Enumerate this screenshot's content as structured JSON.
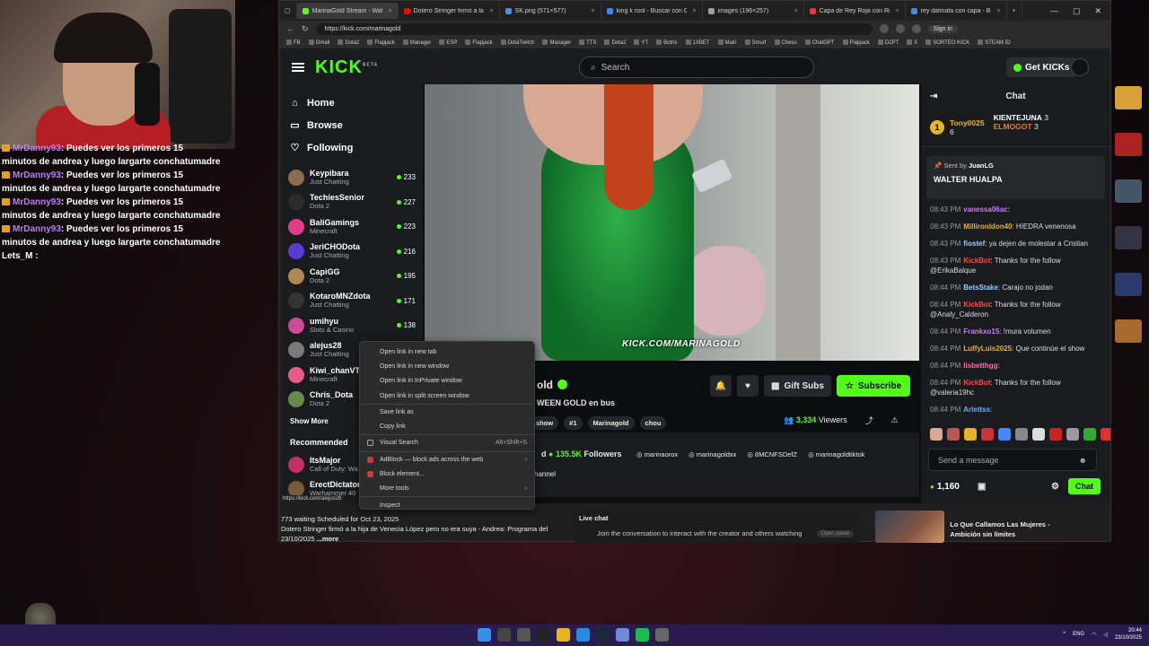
{
  "overlay_chat": [
    {
      "user": "MrDanny93",
      "text": ": Puedes ver los primeros 15",
      "cont": "minutos de andrea y luego largarte conchatumadre"
    },
    {
      "user": "MrDanny93",
      "text": ": Puedes ver los primeros 15",
      "cont": "minutos de andrea y luego largarte conchatumadre"
    },
    {
      "user": "MrDanny93",
      "text": ": Puedes ver los primeros 15",
      "cont": "minutos de andrea y luego largarte conchatumadre"
    },
    {
      "user": "MrDanny93",
      "text": ": Puedes ver los primeros 15",
      "cont": "minutos de andrea y luego largarte conchatumadre"
    }
  ],
  "overlay_last": "Lets_M :",
  "browser": {
    "tabs": [
      {
        "title": "MarinaGold Stream - Watch Liv",
        "color": "#53fc18",
        "active": true
      },
      {
        "title": "Dotero Stringer firmó a la hija d",
        "color": "#ff0000"
      },
      {
        "title": "SK.png (571×577)",
        "color": "#4a8fe8"
      },
      {
        "title": "king k rool - Buscar con Google",
        "color": "#4285f4"
      },
      {
        "title": "images (196×257)",
        "color": "#9aa0a6"
      },
      {
        "title": "Capa de Rey Roja con Ribete d",
        "color": "#e53935"
      },
      {
        "title": "rey dalmata con capa - Buscar",
        "color": "#4285f4"
      }
    ],
    "url": "https://kick.com/marinagold",
    "signin": "Sign in",
    "bookmarks": [
      "FB",
      "Gmail",
      "Dota2",
      "Flapjack",
      "Manager",
      "ESP",
      "Flapjack",
      "DotaTwitch",
      "Manager",
      "TTS",
      "Dota2",
      "YT",
      "Botrix",
      "1XBET",
      "Main",
      "Smurf",
      "Chess",
      "ChatGPT",
      "Flapjack",
      "D2PT",
      "X",
      "SORTEO KICK",
      "STEAM ID"
    ],
    "status_url": "https://kick.com/alejus28"
  },
  "kick": {
    "logo": "KICK",
    "logo_beta": "BETA",
    "search_placeholder": "Search",
    "get_kicks": "Get KICKs",
    "nav": [
      {
        "label": "Home",
        "icon": "home-icon",
        "glyph": "⌂"
      },
      {
        "label": "Browse",
        "icon": "browse-icon",
        "glyph": "▭"
      },
      {
        "label": "Following",
        "icon": "heart-icon",
        "glyph": "♡"
      }
    ],
    "following": [
      {
        "name": "Keypibara",
        "cat": "Just Chatting",
        "count": "233",
        "color": "#8c6b4f"
      },
      {
        "name": "TechiesSenior",
        "cat": "Dota 2",
        "count": "227",
        "color": "#2c2c2c"
      },
      {
        "name": "BaliGamings",
        "cat": "Minecraft",
        "count": "223",
        "color": "#e03c8a"
      },
      {
        "name": "JeriCHODota",
        "cat": "Just Chatting",
        "count": "216",
        "color": "#5a3ad8"
      },
      {
        "name": "CapiGG",
        "cat": "Dota 2",
        "count": "195",
        "color": "#b08850"
      },
      {
        "name": "KotaroMNZdota",
        "cat": "Just Chatting",
        "count": "171",
        "color": "#333333"
      },
      {
        "name": "umihyu",
        "cat": "Slots & Casino",
        "count": "138",
        "color": "#d04a9a"
      },
      {
        "name": "alejus28",
        "cat": "Just Chatting",
        "count": "114",
        "color": "#7a7a7a"
      },
      {
        "name": "Kiwi_chanVT",
        "cat": "Minecraft",
        "count": "",
        "color": "#e85a8a"
      },
      {
        "name": "Chris_Dota",
        "cat": "Dota 2",
        "count": "",
        "color": "#6a8a4a"
      }
    ],
    "show_more": "Show More",
    "recommended_title": "Recommended",
    "recommended": [
      {
        "name": "ItsMajor",
        "cat": "Call of Duty: Wa",
        "color": "#c0306a"
      },
      {
        "name": "ErectDictator",
        "cat": "Warhammer 40",
        "color": "#7a5a3a"
      }
    ],
    "watermark": "KICK.COM/MARINAGOLD",
    "streamer": "Marina",
    "streamer_visible": "old",
    "stream_title": "WEEN GOLD en bus",
    "tags": [
      "show",
      "#1",
      "Marinagold",
      "chou"
    ],
    "gift_subs": "Gift Subs",
    "subscribe": "Subscribe",
    "viewers": "3,334",
    "viewers_label": "Viewers",
    "followers_prefix": "d",
    "followers": "135.5K",
    "followers_label": "Followers",
    "socials": [
      "marinaorox",
      "marinagoldxx",
      "8MCNFSDefZ",
      "marinagoldtiktok"
    ],
    "channel_text": "hannel"
  },
  "chat": {
    "title": "Chat",
    "leaderboard": [
      {
        "name": "Tony0025",
        "num": "6",
        "rank": "1"
      },
      {
        "name": "KIENTEJUNA",
        "num": "3"
      },
      {
        "name": "ELMOGOT",
        "num": "3"
      }
    ],
    "pinned_by": "Sent by",
    "pinned_user": "JuanLG",
    "pinned_msg": "WALTER HUALPA",
    "messages": [
      {
        "t": "08:43 PM",
        "u": "vanessa06ac",
        "c": "#c77dff",
        "m": ":"
      },
      {
        "t": "08:43 PM",
        "u": "Millironldon40",
        "c": "#e6b422",
        "m": ": HIEDRA venenosa"
      },
      {
        "t": "08:43 PM",
        "u": "fiostef",
        "c": "#9ad0ff",
        "m": ": ya dejen de molestar a Cristian"
      },
      {
        "t": "08:43 PM",
        "u": "KickBot",
        "c": "#ff4a4a",
        "m": ": Thanks for the follow @ErikaBalque"
      },
      {
        "t": "08:44 PM",
        "u": "BetsStake",
        "c": "#9ad0ff",
        "m": ": Carajo no jodan"
      },
      {
        "t": "08:44 PM",
        "u": "KickBot",
        "c": "#ff4a4a",
        "m": ": Thanks for the follow @Analy_Calderon"
      },
      {
        "t": "08:44 PM",
        "u": "Frankxo15",
        "c": "#c77dff",
        "m": ": !mura volumen"
      },
      {
        "t": "08:44 PM",
        "u": "LuffyLuis2025",
        "c": "#e6b422",
        "m": ": Que continúe el show"
      },
      {
        "t": "08:44 PM",
        "u": "lisbetthgg",
        "c": "#ff6fa8",
        "m": ":"
      },
      {
        "t": "08:44 PM",
        "u": "KickBot",
        "c": "#ff4a4a",
        "m": ": Thanks for the follow @valeria19hc"
      },
      {
        "t": "08:44 PM",
        "u": "Arlettss",
        "c": "#6ab0ff",
        "m": ":"
      }
    ],
    "send_placeholder": "Send a message",
    "kicks": "1,160",
    "chat_button": "Chat"
  },
  "context_menu": [
    {
      "label": "Open link in new tab"
    },
    {
      "label": "Open link in new window"
    },
    {
      "label": "Open link in InPrivate window"
    },
    {
      "label": "Open link in split screen window"
    },
    {
      "sep": true
    },
    {
      "label": "Save link as"
    },
    {
      "label": "Copy link"
    },
    {
      "sep": true
    },
    {
      "label": "Visual Search",
      "shortcut": "Alt+Shift+S"
    },
    {
      "sep": true
    },
    {
      "label": "AdBlock — block ads across the web",
      "arrow": true
    },
    {
      "label": "Block element..."
    },
    {
      "label": "More tools",
      "arrow": true
    },
    {
      "sep": true
    },
    {
      "label": "Inspect"
    }
  ],
  "youtube": {
    "meta": "773 waiting  Scheduled for Oct 23, 2025",
    "title": "Dotero Stringer firmó a la hija de Venecia López pero no era suya - Andrea: Programa del 23/10/2025",
    "more": "...more",
    "live_chat": "Live chat",
    "live_join": "Join the conversation to interact with the creator and others watching",
    "open_panel": "Open panel",
    "video_title": "Lo Que Callamos Las Mujeres - Ambición sin límites"
  },
  "taskbar": {
    "lang": "ENG",
    "time": "20:44",
    "date": "23/10/2025"
  }
}
